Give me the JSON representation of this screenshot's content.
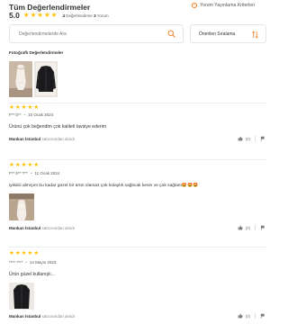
{
  "header": {
    "title": "Tüm Değerlendirmeler",
    "criteria_label": "Yorum Yayınlama Kriterleri",
    "score": "5.0",
    "rating_count": "4",
    "rating_label": "Değerlendirme",
    "comment_count": "3",
    "comment_label": "Yorum"
  },
  "search": {
    "placeholder": "Değerlendirmelerde Ara"
  },
  "sort": {
    "selected": "Önerilen Sıralama"
  },
  "photos": {
    "title": "Fotoğraflı Değerlendirmeler"
  },
  "reviews": [
    {
      "stars": 5,
      "author": "F** b**",
      "date": "10 Ocak 2024",
      "text": "Ürünü çok beğendim çok kaliteli tavsiye ederim",
      "seller_name": "Mankan İstanbul",
      "seller_suffix": "satıcısından alındı",
      "likes": "(0)"
    },
    {
      "stars": 5,
      "author": "F** b** T**",
      "date": "11 Ocak 2024",
      "text": "iyikiiiiii almışım bu kadar güzel bir ürün olamaz çok kolaylık sağlıcak kesin ve çok sağlam🤩🤩🤩",
      "seller_name": "Mankan İstanbul",
      "seller_suffix": "satıcısından alındı",
      "likes": "(0)"
    },
    {
      "stars": 5,
      "author": "**** ****",
      "date": "14 Mayıs 2023",
      "text": "Ürün güzel kullanışlı...",
      "seller_name": "Mankan İstanbul",
      "seller_suffix": "satıcısından alındı",
      "likes": "(0)"
    }
  ],
  "colors": {
    "accent": "#f27a1a",
    "star": "#ffc000"
  }
}
